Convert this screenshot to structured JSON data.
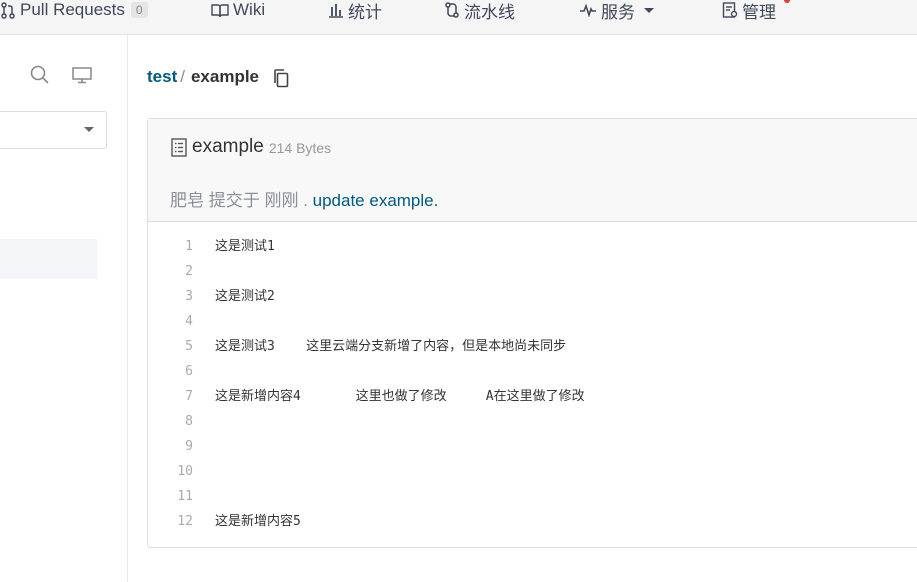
{
  "nav": {
    "pull_requests": "Pull Requests",
    "pull_requests_count": "0",
    "wiki": "Wiki",
    "stats": "统计",
    "pipeline": "流水线",
    "services": "服务",
    "manage": "管理"
  },
  "breadcrumb": {
    "owner": "test",
    "separator": "/",
    "file": "example"
  },
  "file": {
    "name": "example",
    "size": "214 Bytes",
    "commit_prefix": "肥皂 提交于 刚刚 .",
    "commit_message": "update example."
  },
  "code_lines": [
    {
      "num": "1",
      "text": "这是测试1"
    },
    {
      "num": "2",
      "text": ""
    },
    {
      "num": "3",
      "text": "这是测试2"
    },
    {
      "num": "4",
      "text": ""
    },
    {
      "num": "5",
      "text": "这是测试3    这里云端分支新增了内容，但是本地尚未同步"
    },
    {
      "num": "6",
      "text": ""
    },
    {
      "num": "7",
      "text": "这是新增内容4       这里也做了修改     A在这里做了修改"
    },
    {
      "num": "8",
      "text": ""
    },
    {
      "num": "9",
      "text": ""
    },
    {
      "num": "10",
      "text": ""
    },
    {
      "num": "11",
      "text": ""
    },
    {
      "num": "12",
      "text": "这是新增内容5"
    }
  ],
  "colors": {
    "link": "#005980",
    "notification": "#e53935"
  }
}
